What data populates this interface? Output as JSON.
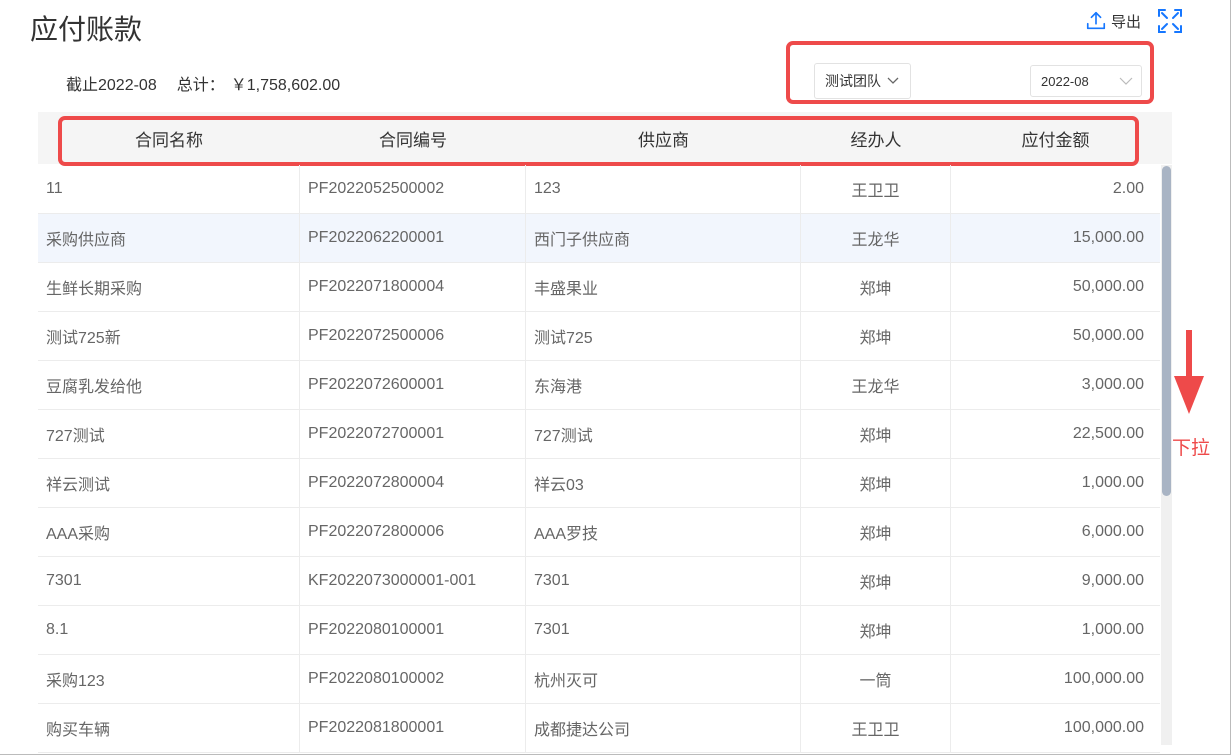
{
  "page": {
    "title": "应付账款"
  },
  "toolbar": {
    "export_label": "导出",
    "export_icon": "upload-icon",
    "fullscreen_icon": "fullscreen-icon"
  },
  "summary": {
    "cutoff": "截止2022-08",
    "total_label": "总计：",
    "total_value": "￥1,758,602.00"
  },
  "filters": {
    "team": "测试团队",
    "date": "2022-08"
  },
  "table": {
    "columns": [
      "合同名称",
      "合同编号",
      "供应商",
      "经办人",
      "应付金额"
    ],
    "rows": [
      [
        "11",
        "PF2022052500002",
        "123",
        "王卫卫",
        "2.00"
      ],
      [
        "采购供应商",
        "PF2022062200001",
        "西门子供应商",
        "王龙华",
        "15,000.00"
      ],
      [
        "生鲜长期采购",
        "PF2022071800004",
        "丰盛果业",
        "郑坤",
        "50,000.00"
      ],
      [
        "测试725新",
        "PF2022072500006",
        "测试725",
        "郑坤",
        "50,000.00"
      ],
      [
        "豆腐乳发给他",
        "PF2022072600001",
        "东海港",
        "王龙华",
        "3,000.00"
      ],
      [
        "727测试",
        "PF2022072700001",
        "727测试",
        "郑坤",
        "22,500.00"
      ],
      [
        "祥云测试",
        "PF2022072800004",
        "祥云03",
        "郑坤",
        "1,000.00"
      ],
      [
        "AAA采购",
        "PF2022072800006",
        "AAA罗技",
        "郑坤",
        "6,000.00"
      ],
      [
        "7301",
        "KF2022073000001-001",
        "7301",
        "郑坤",
        "9,000.00"
      ],
      [
        "8.1",
        "PF2022080100001",
        "7301",
        "郑坤",
        "1,000.00"
      ],
      [
        "采购123",
        "PF2022080100002",
        "杭州灭可",
        "一筒",
        "100,000.00"
      ],
      [
        "购买车辆",
        "PF2022081800001",
        "成都捷达公司",
        "王卫卫",
        "100,000.00"
      ]
    ],
    "highlighted_row": 1
  },
  "annotation": {
    "pull_label": "下拉",
    "color": "#ee4a4a"
  },
  "colors": {
    "accent": "#1677ff",
    "header_bg": "#f5f5f5",
    "highlight_row": "#f2f6fd",
    "annotation_red": "#ee4a4a"
  }
}
